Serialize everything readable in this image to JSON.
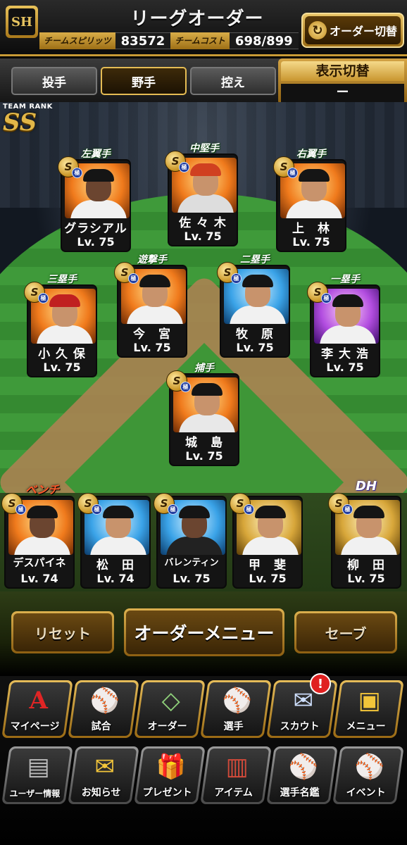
{
  "header": {
    "title": "リーグオーダー",
    "logo_text": "SH",
    "team_spirit_label": "チームスピリッツ",
    "team_spirit_value": "83572",
    "team_cost_label": "チームコスト",
    "team_cost_value": "698/899",
    "order_switch_label": "オーダー切替",
    "order_switch_icon": "swap-arrows-icon"
  },
  "tabs": [
    {
      "label": "投手",
      "active": false
    },
    {
      "label": "野手",
      "active": true
    },
    {
      "label": "控え",
      "active": false
    }
  ],
  "display_toggle": {
    "title": "表示切替",
    "value": "ー"
  },
  "team_rank": {
    "label": "TEAM RANK",
    "value": "SS"
  },
  "field_players": [
    {
      "position": "左翼手",
      "name": "グラシアル",
      "level": "Lv. 75",
      "badge": "S",
      "photo": "orange"
    },
    {
      "position": "中堅手",
      "name": "佐 々 木",
      "level": "Lv. 75",
      "badge": "S",
      "photo": "orange"
    },
    {
      "position": "右翼手",
      "name": "上　林",
      "level": "Lv. 75",
      "badge": "S",
      "photo": "orange"
    },
    {
      "position": "遊撃手",
      "name": "今　宮",
      "level": "Lv. 75",
      "badge": "S",
      "photo": "orange"
    },
    {
      "position": "二塁手",
      "name": "牧　原",
      "level": "Lv. 75",
      "badge": "S",
      "photo": "blue"
    },
    {
      "position": "三塁手",
      "name": "小 久 保",
      "level": "Lv. 75",
      "badge": "S",
      "photo": "orange"
    },
    {
      "position": "一塁手",
      "name": "李 大 浩",
      "level": "Lv. 75",
      "badge": "S",
      "photo": "purple"
    },
    {
      "position": "捕手",
      "name": "城　島",
      "level": "Lv. 75",
      "badge": "S",
      "photo": "orange"
    }
  ],
  "bench": {
    "label": "ベンチ",
    "players": [
      {
        "name": "デスパイネ",
        "level": "Lv. 74",
        "badge": "S",
        "photo": "orange"
      },
      {
        "name": "松　田",
        "level": "Lv. 74",
        "badge": "S",
        "photo": "blue"
      },
      {
        "name": "バレンティン",
        "level": "Lv. 75",
        "badge": "S",
        "photo": "blue"
      },
      {
        "name": "甲　斐",
        "level": "Lv. 75",
        "badge": "S",
        "photo": "gold"
      }
    ]
  },
  "dh": {
    "label": "DH",
    "name": "柳　田",
    "level": "Lv. 75",
    "badge": "S",
    "photo": "gold"
  },
  "badge_sub": "極",
  "order_buttons": {
    "reset": "リセット",
    "menu": "オーダーメニュー",
    "save": "セーブ"
  },
  "nav_row1": [
    {
      "label": "マイページ",
      "icon": "A"
    },
    {
      "label": "試合",
      "icon": "⚾"
    },
    {
      "label": "オーダー",
      "icon": "◇"
    },
    {
      "label": "選手",
      "icon": "⚾"
    },
    {
      "label": "スカウト",
      "icon": "✉"
    },
    {
      "label": "メニュー",
      "icon": "▣"
    }
  ],
  "nav_row2": [
    {
      "label": "ユーザー情報",
      "icon": "▤"
    },
    {
      "label": "お知らせ",
      "icon": "✉"
    },
    {
      "label": "プレゼント",
      "icon": "🎁"
    },
    {
      "label": "アイテム",
      "icon": "▥"
    },
    {
      "label": "選手名鑑",
      "icon": "⚾"
    },
    {
      "label": "イベント",
      "icon": "⚾"
    }
  ],
  "scout_notification": "!"
}
